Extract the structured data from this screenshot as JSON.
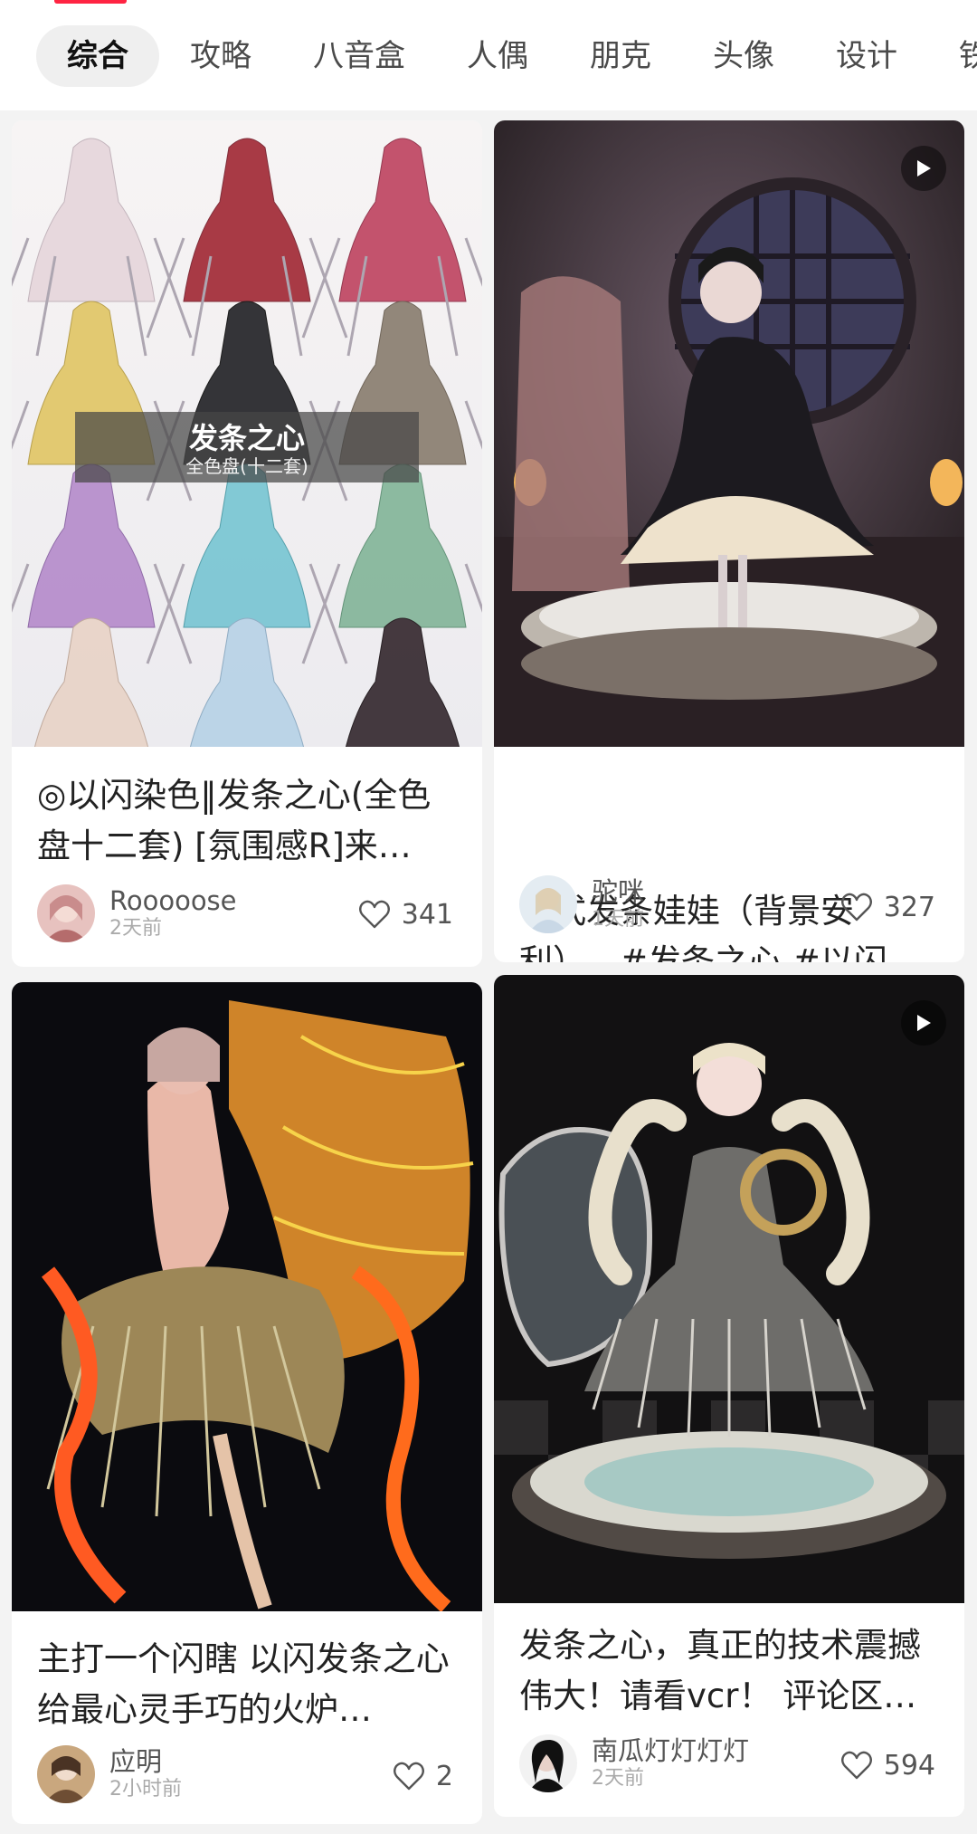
{
  "tabs": [
    {
      "label": "综合",
      "active": true
    },
    {
      "label": "攻略"
    },
    {
      "label": "八音盒"
    },
    {
      "label": "人偶"
    },
    {
      "label": "朋克"
    },
    {
      "label": "头像"
    },
    {
      "label": "设计"
    },
    {
      "label": "铁"
    }
  ],
  "accent_color": "#ff2442",
  "cards": [
    {
      "title": "◎以闪染色‖发条之心(全色盘十二套) [氛围感R]来…",
      "overlay_title": "发条之心",
      "overlay_subtitle": "全色盘(十二套)",
      "author": "Rooooose",
      "time": "2天前",
      "likes": "341",
      "is_video": false
    },
    {
      "title": "中式发条娃娃（背景安利）…#发条之心 #以闪…",
      "author": "驼咪",
      "time": "1天前",
      "likes": "327",
      "is_video": true
    },
    {
      "title": "主打一个闪瞎 以闪发条之心 给最心灵手巧的火炉…",
      "author": "应明",
      "time": "2小时前",
      "likes": "2",
      "is_video": false
    },
    {
      "title": "发条之心，真正的技术震撼伟大！请看vcr！ 评论区…",
      "author": "南瓜灯灯灯灯",
      "time": "2天前",
      "likes": "594",
      "is_video": true
    }
  ]
}
